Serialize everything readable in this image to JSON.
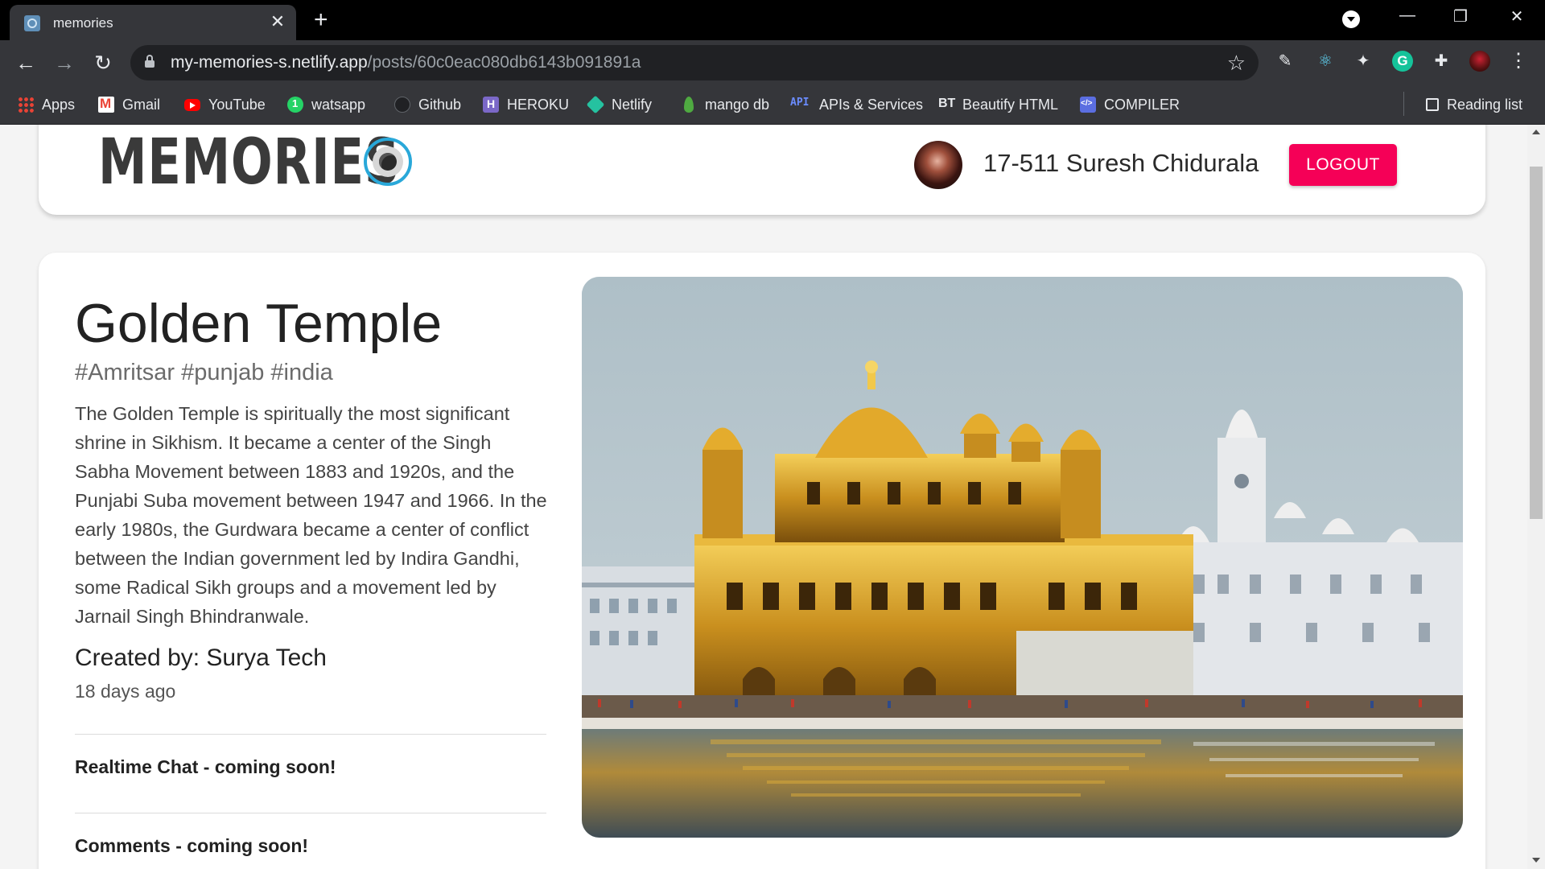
{
  "browser": {
    "tab_title": "memories",
    "url_host": "my-memories-s.netlify.app",
    "url_path": "/posts/60c0eac080db6143b091891a",
    "bookmarks": [
      {
        "label": "Apps",
        "icon": "apps-grid-icon"
      },
      {
        "label": "Gmail",
        "icon": "gmail-icon"
      },
      {
        "label": "YouTube",
        "icon": "youtube-icon"
      },
      {
        "label": "watsapp",
        "icon": "whatsapp-icon"
      },
      {
        "label": "Github",
        "icon": "github-icon"
      },
      {
        "label": "HEROKU",
        "icon": "heroku-icon"
      },
      {
        "label": "Netlify",
        "icon": "netlify-icon"
      },
      {
        "label": "mango db",
        "icon": "mongodb-leaf-icon"
      },
      {
        "label": "APIs & Services",
        "icon": "api-icon"
      },
      {
        "label": "Beautify HTML",
        "icon": "bt-icon"
      },
      {
        "label": "COMPILER",
        "icon": "compiler-icon"
      }
    ],
    "reading_list": "Reading list",
    "api_icon_text": "API",
    "bt_icon_text": "BT"
  },
  "app": {
    "logo_text": "MEMORIES",
    "user_name": "17-511 Suresh Chidurala",
    "logout_label": "LOGOUT",
    "accent_color": "#f50057",
    "logo_accent_color": "#29a8d9"
  },
  "post": {
    "title": "Golden Temple",
    "tags": "#Amritsar #punjab #india",
    "message": "The Golden Temple is spiritually the most significant shrine in Sikhism. It became a center of the Singh Sabha Movement between 1883 and 1920s, and the Punjabi Suba movement between 1947 and 1966. In the early 1980s, the Gurdwara became a center of conflict between the Indian government led by Indira Gandhi, some Radical Sikh groups and a movement led by Jarnail Singh Bhindranwale.",
    "created_by": "Created by: Surya Tech",
    "time_ago": "18 days ago",
    "realtime_chat": "Realtime Chat - coming soon!",
    "comments": "Comments - coming soon!"
  }
}
